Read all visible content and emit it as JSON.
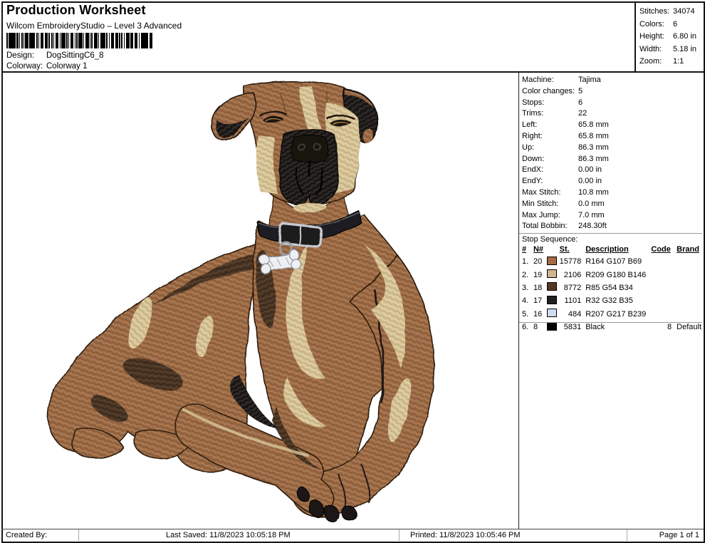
{
  "header": {
    "title": "Production Worksheet",
    "subtitle": "Wilcom EmbroideryStudio – Level 3 Advanced",
    "design_label": "Design:",
    "design_value": "DogSittingC6_8",
    "colorway_label": "Colorway:",
    "colorway_value": "Colorway 1",
    "stats": [
      {
        "label": "Stitches:",
        "value": "34074"
      },
      {
        "label": "Colors:",
        "value": "6"
      },
      {
        "label": "Height:",
        "value": "6.80 in"
      },
      {
        "label": "Width:",
        "value": "5.18 in"
      },
      {
        "label": "Zoom:",
        "value": "1:1"
      }
    ]
  },
  "machine_info": {
    "rows": [
      {
        "label": "Machine:",
        "value": "Tajima"
      },
      {
        "label": "Color changes:",
        "value": "5"
      },
      {
        "label": "Stops:",
        "value": "6"
      },
      {
        "label": "Trims:",
        "value": "22"
      },
      {
        "label": "Left:",
        "value": "65.8 mm"
      },
      {
        "label": "Right:",
        "value": "65.8 mm"
      },
      {
        "label": "Up:",
        "value": "86.3 mm"
      },
      {
        "label": "Down:",
        "value": "86.3 mm"
      },
      {
        "label": "EndX:",
        "value": "0.00 in"
      },
      {
        "label": "EndY:",
        "value": "0.00 in"
      },
      {
        "label": "Max Stitch:",
        "value": "10.8 mm"
      },
      {
        "label": "Min Stitch:",
        "value": "0.0 mm"
      },
      {
        "label": "Max Jump:",
        "value": "7.0 mm"
      },
      {
        "label": "Total Bobbin:",
        "value": "248.30ft"
      }
    ]
  },
  "stop_sequence": {
    "title": "Stop Sequence:",
    "columns": [
      "#",
      "N#",
      "St.",
      "Description",
      "Code",
      "Brand"
    ],
    "rows": [
      {
        "num": "1.",
        "needle": "20",
        "color": "#A46B45",
        "stitches": "15778",
        "description": "R164 G107 B69",
        "code": "",
        "brand": ""
      },
      {
        "num": "2.",
        "needle": "19",
        "color": "#D1B492",
        "stitches": "2106",
        "description": "R209 G180 B146",
        "code": "",
        "brand": ""
      },
      {
        "num": "3.",
        "needle": "18",
        "color": "#553622",
        "stitches": "8772",
        "description": "R85 G54 B34",
        "code": "",
        "brand": ""
      },
      {
        "num": "4.",
        "needle": "17",
        "color": "#202023",
        "stitches": "1101",
        "description": "R32 G32 B35",
        "code": "",
        "brand": ""
      },
      {
        "num": "5.",
        "needle": "16",
        "color": "#CFD9EF",
        "stitches": "484",
        "description": "R207 G217 B239",
        "code": "",
        "brand": ""
      },
      {
        "num": "6.",
        "needle": "8",
        "color": "#000000",
        "stitches": "5831",
        "description": "Black",
        "code": "8",
        "brand": "Default"
      }
    ]
  },
  "design_area": {
    "description": "Embroidery design preview: brindle dog lying down with black collar and bone tag"
  },
  "footer": {
    "created_by": "Created By:",
    "last_saved": "Last Saved: 11/8/2023 10:05:18 PM",
    "printed": "Printed: 11/8/2023 10:05:46 PM",
    "page": "Page 1 of 1"
  }
}
